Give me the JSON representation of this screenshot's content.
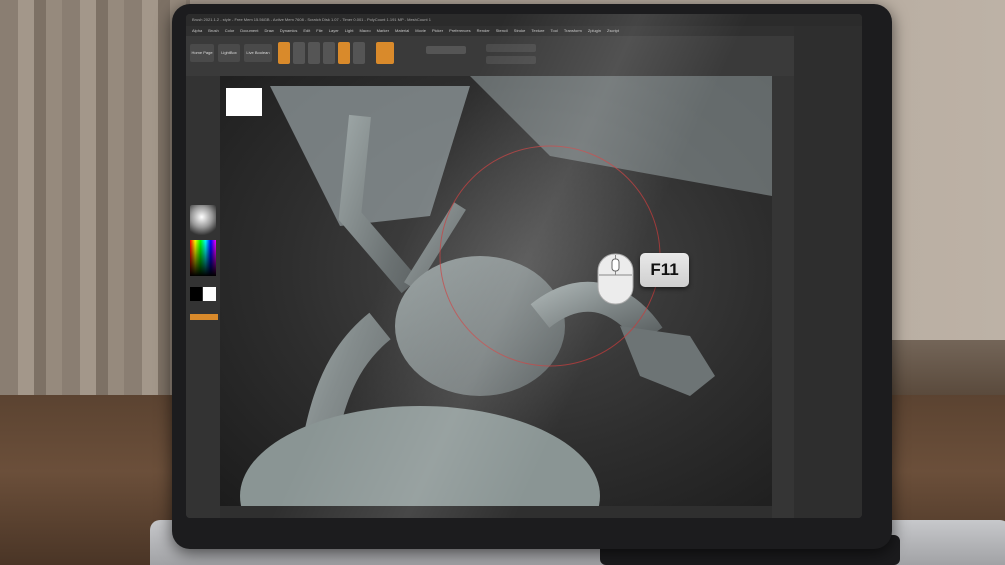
{
  "overlay": {
    "shortcut_key": "F11",
    "mouse_icon": "mouse-icon"
  },
  "app": {
    "title": "Brush 2021.1.2 - style - Free Mem 15.56GB - Active Mem 7608 - Scratch Disk 1.07 - Timer 0.001 - PolyCount 1.191 MP - MeshCount 1",
    "menus": [
      "Alpha",
      "Brush",
      "Color",
      "Document",
      "Draw",
      "Dynamics",
      "Edit",
      "File",
      "Layer",
      "Light",
      "Macro",
      "Marker",
      "Material",
      "Movie",
      "Picker",
      "Preferences",
      "Render",
      "Stencil",
      "Stroke",
      "Texture",
      "Tool",
      "Transform",
      "Zplugin",
      "Zscript"
    ]
  },
  "toolbar": {
    "home_page": "Home Page",
    "lightbox": "LightBox",
    "live_boolean": "Live Boolean"
  },
  "colors": {
    "accent": "#d98a2b",
    "ui_dark": "#2e2e2e"
  }
}
